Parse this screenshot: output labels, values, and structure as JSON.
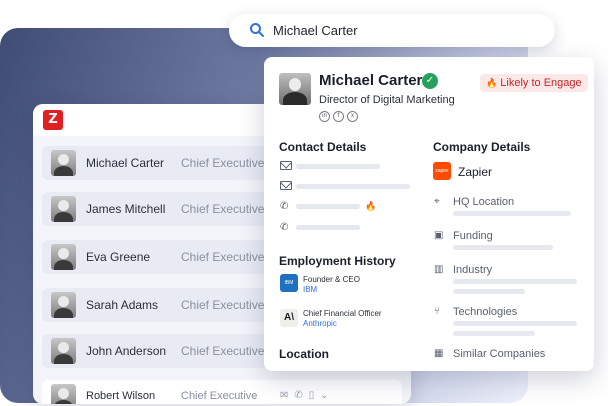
{
  "search": {
    "query": "Michael Carter"
  },
  "list": {
    "rows": [
      {
        "name": "Michael Carter",
        "title": "Chief Executive"
      },
      {
        "name": "James Mitchell",
        "title": "Chief Executive"
      },
      {
        "name": "Eva Greene",
        "title": "Chief Executive"
      },
      {
        "name": "Sarah Adams",
        "title": "Chief Executive"
      },
      {
        "name": "John Anderson",
        "title": "Chief Executive"
      },
      {
        "name": "Robert Wilson",
        "title": "Chief Executive"
      }
    ]
  },
  "profile": {
    "name": "Michael Carter",
    "role": "Director of Digital Marketing",
    "engage_label": "Likely to Engage",
    "socials": [
      "in",
      "f",
      "x"
    ]
  },
  "contact": {
    "title": "Contact Details"
  },
  "employment": {
    "title": "Employment History",
    "items": [
      {
        "role": "Founder & CEO",
        "company": "IBM",
        "logo": "IBM"
      },
      {
        "role": "Chief Financial Officer",
        "company": "Anthropic",
        "logo": "A\\"
      }
    ]
  },
  "location": {
    "title": "Location"
  },
  "company": {
    "title": "Company Details",
    "name": "Zapier",
    "logo_text": "zapier",
    "fields": [
      "HQ Location",
      "Funding",
      "Industry",
      "Technologies",
      "Similar Companies"
    ]
  },
  "colors": {
    "accent_red": "#e02020",
    "zapier_orange": "#ff4a00",
    "ibm_blue": "#1f70c1",
    "verified_green": "#26a15a"
  }
}
